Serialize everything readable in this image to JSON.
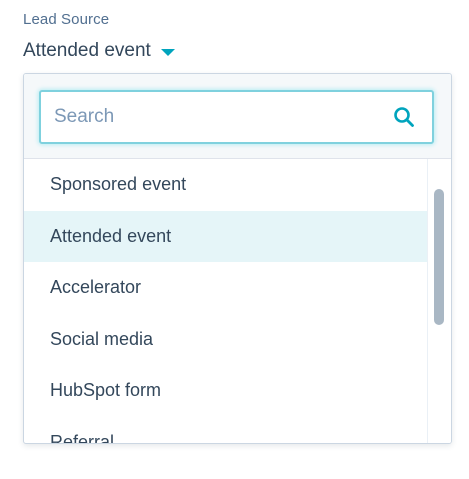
{
  "field": {
    "label": "Lead Source",
    "value": "Attended event"
  },
  "dropdown": {
    "search_placeholder": "Search",
    "search_value": "",
    "options": [
      {
        "label": "Sponsored event",
        "selected": false
      },
      {
        "label": "Attended event",
        "selected": true
      },
      {
        "label": "Accelerator",
        "selected": false
      },
      {
        "label": "Social media",
        "selected": false
      },
      {
        "label": "HubSpot form",
        "selected": false
      },
      {
        "label": "Referral",
        "selected": false
      }
    ]
  },
  "icons": {
    "caret": "caret-down-icon",
    "search": "search-icon"
  },
  "colors": {
    "accent": "#00a4bd",
    "text": "#33475b",
    "label": "#516f90",
    "placeholder": "#7c98b6",
    "selected_bg": "#e5f5f8",
    "search_focus_border": "#7fd1de",
    "search_bar_bg": "#f5f8fa"
  }
}
